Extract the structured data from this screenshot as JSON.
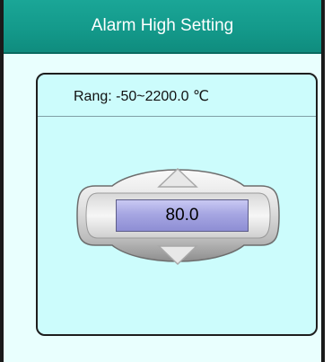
{
  "window": {
    "title": "Alarm High Setting"
  },
  "setting": {
    "range_label": "Rang: -50~2200.0 ℃",
    "value": "80.0"
  },
  "colors": {
    "title_bar": "#149a8b",
    "panel_background": "#ccfcfc",
    "value_box": "#a6a6e2"
  },
  "icons": {
    "increase": "up-arrow-icon",
    "decrease": "down-arrow-icon"
  }
}
